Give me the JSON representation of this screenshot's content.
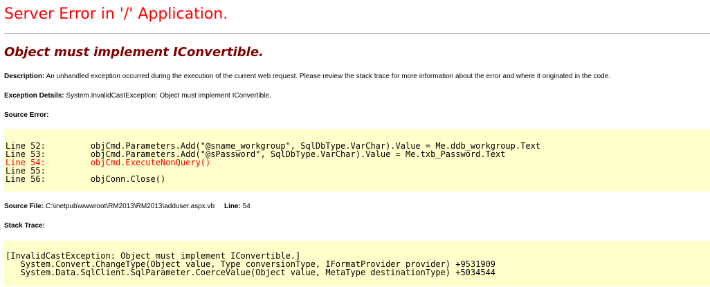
{
  "title": "Server Error in '/' Application.",
  "error_message": "Object must implement IConvertible.",
  "description": {
    "label": "Description:",
    "text": "An unhandled exception occurred during the execution of the current web request. Please review the stack trace for more information about the error and where it originated in the code."
  },
  "exception_details": {
    "label": "Exception Details:",
    "text": "System.InvalidCastException: Object must implement IConvertible."
  },
  "source_error": {
    "heading": "Source Error:",
    "lines": [
      {
        "text": "Line 52:         objCmd.Parameters.Add(\"@sname_workgroup\", SqlDbType.VarChar).Value = Me.ddb_workgroup.Text",
        "error": false
      },
      {
        "text": "Line 53:         objCmd.Parameters.Add(\"@sPassword\", SqlDbType.VarChar).Value = Me.txb_Password.Text",
        "error": false
      },
      {
        "text": "Line 54:         objCmd.ExecuteNonQuery()",
        "error": true
      },
      {
        "text": "Line 55:",
        "error": false
      },
      {
        "text": "Line 56:         objConn.Close()",
        "error": false
      }
    ]
  },
  "source_file": {
    "label": "Source File:",
    "path": "C:\\inetpub\\wwwroot\\RM2013\\RM2013\\adduser.aspx.vb",
    "line_label": "Line:",
    "line_number": "54"
  },
  "stack_trace": {
    "heading": "Stack Trace:",
    "lines": [
      "[InvalidCastException: Object must implement IConvertible.]",
      "   System.Convert.ChangeType(Object value, Type conversionType, IFormatProvider provider) +9531909",
      "   System.Data.SqlClient.SqlParameter.CoerceValue(Object value, MetaType destinationType) +5034544"
    ]
  },
  "colors": {
    "title": "#ff0000",
    "subtitle": "#800000",
    "code_background": "#ffffcc",
    "error_line": "#ff0000"
  }
}
